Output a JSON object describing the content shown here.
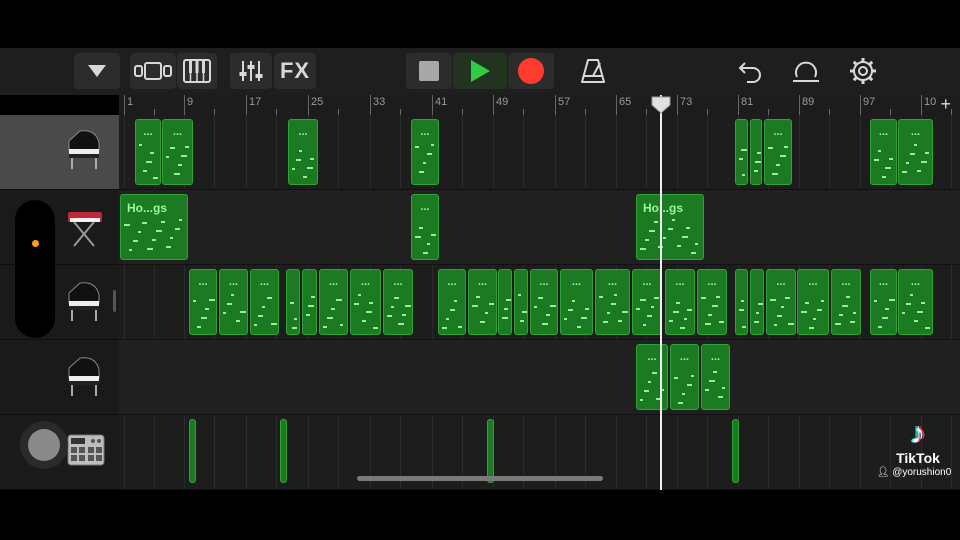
{
  "toolbar": {
    "fx_label": "FX"
  },
  "ruler": {
    "bars": [
      "1",
      "9",
      "17",
      "25",
      "33",
      "41",
      "49",
      "57",
      "65",
      "73",
      "81",
      "89",
      "97",
      "10"
    ]
  },
  "tracks": [
    {
      "instrument": "grand-piano-icon",
      "selected": true
    },
    {
      "instrument": "synth-keyboard-icon",
      "selected": false
    },
    {
      "instrument": "grand-piano-icon",
      "selected": false
    },
    {
      "instrument": "grand-piano-icon",
      "selected": false
    },
    {
      "instrument": "drum-machine-icon",
      "selected": false
    }
  ],
  "regions": {
    "named_label": "Ho...gs",
    "dots": "..."
  },
  "colors": {
    "region_fill": "#1c7a22",
    "region_border": "#2fa336",
    "play": "#2ecc40",
    "record": "#ff3b30",
    "volume_dot": "#ff9f0a"
  },
  "watermark": {
    "brand": "TikTok",
    "user": "@yorushion0"
  }
}
